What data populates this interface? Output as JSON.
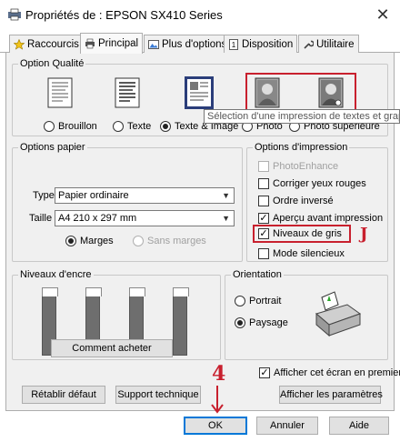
{
  "window": {
    "title": "Propriétés de : EPSON SX410 Series"
  },
  "tabs": [
    {
      "label": "Raccourcis"
    },
    {
      "label": "Principal"
    },
    {
      "label": "Plus d'options"
    },
    {
      "label": "Disposition"
    },
    {
      "label": "Utilitaire"
    }
  ],
  "quality": {
    "legend": "Option Qualité",
    "options": [
      {
        "label": "Brouillon",
        "selected": false
      },
      {
        "label": "Texte",
        "selected": false
      },
      {
        "label": "Texte & Image",
        "selected": true
      },
      {
        "label": "Photo",
        "selected": false
      },
      {
        "label": "Photo supérieure",
        "selected": false
      }
    ],
    "tooltip": "Sélection d'une impression de textes et graphiques"
  },
  "paper": {
    "legend": "Options papier",
    "type_label": "Type",
    "type_value": "Papier ordinaire",
    "size_label": "Taille",
    "size_value": "A4 210 x 297 mm",
    "margins": {
      "label": "Marges",
      "selected": true
    },
    "no_margins": {
      "label": "Sans marges",
      "selected": false
    }
  },
  "print_options": {
    "legend": "Options d'impression",
    "items": [
      {
        "label": "PhotoEnhance",
        "checked": false,
        "disabled": true
      },
      {
        "label": "Corriger yeux rouges",
        "checked": false,
        "disabled": false
      },
      {
        "label": "Ordre inversé",
        "checked": false,
        "disabled": false
      },
      {
        "label": "Aperçu avant impression",
        "checked": true,
        "disabled": false
      },
      {
        "label": "Niveaux de gris",
        "checked": true,
        "disabled": false
      },
      {
        "label": "Mode silencieux",
        "checked": false,
        "disabled": false
      }
    ]
  },
  "ink": {
    "legend": "Niveaux d'encre",
    "buy_button": "Comment acheter"
  },
  "orientation": {
    "legend": "Orientation",
    "portrait": {
      "label": "Portrait",
      "selected": false
    },
    "landscape": {
      "label": "Paysage",
      "selected": true
    }
  },
  "show_screen_first": {
    "label": "Afficher cet écran en premier",
    "checked": true
  },
  "buttons": {
    "restore": "Rétablir défaut",
    "support": "Support technique",
    "show_settings": "Afficher les paramètres",
    "ok": "OK",
    "cancel": "Annuler",
    "help": "Aide"
  },
  "annotations": {
    "j_mark": "J",
    "four_mark": "4"
  },
  "colors": {
    "annotation_red": "#c8202e",
    "focus_blue": "#0078d7"
  }
}
